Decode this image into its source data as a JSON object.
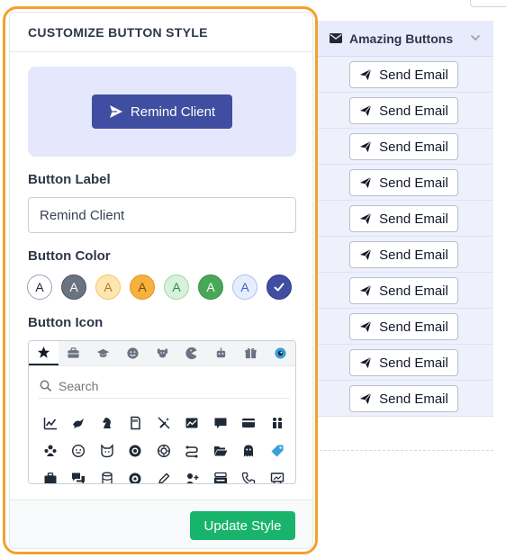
{
  "grid": {
    "column_header": "Amazing Buttons",
    "header_icon": "envelope-icon",
    "rows": [
      {
        "button_label": "Send Email",
        "icon": "paper-plane-icon"
      },
      {
        "button_label": "Send Email",
        "icon": "paper-plane-icon"
      },
      {
        "button_label": "Send Email",
        "icon": "paper-plane-icon"
      },
      {
        "button_label": "Send Email",
        "icon": "paper-plane-icon"
      },
      {
        "button_label": "Send Email",
        "icon": "paper-plane-icon"
      },
      {
        "button_label": "Send Email",
        "icon": "paper-plane-icon"
      },
      {
        "button_label": "Send Email",
        "icon": "paper-plane-icon"
      },
      {
        "button_label": "Send Email",
        "icon": "paper-plane-icon"
      },
      {
        "button_label": "Send Email",
        "icon": "paper-plane-icon"
      },
      {
        "button_label": "Send Email",
        "icon": "paper-plane-icon"
      }
    ]
  },
  "panel": {
    "title": "CUSTOMIZE BUTTON STYLE",
    "preview": {
      "label": "Remind Client",
      "icon": "paper-plane-icon",
      "color": "#3f4ea0"
    },
    "button_label": {
      "heading": "Button Label",
      "value": "Remind Client"
    },
    "button_color": {
      "heading": "Button Color",
      "swatches": [
        {
          "text": "A",
          "bg": "#ffffff",
          "fg": "#1f2937",
          "border": "#9ca3af",
          "selected": false
        },
        {
          "text": "A",
          "bg": "#6b7280",
          "fg": "#ffffff",
          "border": "#4b5563",
          "selected": false
        },
        {
          "text": "A",
          "bg": "#fde6b0",
          "fg": "#b7791f",
          "border": "#f6c46a",
          "selected": false
        },
        {
          "text": "A",
          "bg": "#f6b13f",
          "fg": "#7c4a03",
          "border": "#e0962a",
          "selected": false
        },
        {
          "text": "A",
          "bg": "#d6f2d9",
          "fg": "#2f855a",
          "border": "#9fd9a8",
          "selected": false
        },
        {
          "text": "A",
          "bg": "#48a857",
          "fg": "#ffffff",
          "border": "#3b8f49",
          "selected": false
        },
        {
          "text": "A",
          "bg": "#e6eefe",
          "fg": "#3b63d6",
          "border": "#a9bff2",
          "selected": false
        },
        {
          "text": "",
          "bg": "#3f4ea0",
          "fg": "#ffffff",
          "border": "#2f3c85",
          "selected": true
        }
      ]
    },
    "button_icon": {
      "heading": "Button Icon",
      "categories": [
        "star-icon",
        "briefcase-icon",
        "graduation-cap-icon",
        "smiley-icon",
        "dog-icon",
        "pacman-icon",
        "robot-icon",
        "gift-icon",
        "eye-icon"
      ],
      "active_category": 0,
      "search_placeholder": "Search",
      "icons": [
        "chart-line-icon",
        "bird-icon",
        "chess-knight-icon",
        "sd-card-icon",
        "wand-slash-icon",
        "image-chart-icon",
        "comment-icon",
        "credit-card-icon",
        "people-icon",
        "user-group-icon",
        "face-icon",
        "cat-face-icon",
        "badge-icon",
        "gear-circle-icon",
        "route-icon",
        "folder-open-icon",
        "ghost-icon",
        "tag-icon",
        "suitcase-icon",
        "chat-icon",
        "database-icon",
        "target-icon",
        "pen-icon",
        "user-plus-icon",
        "tray-icon",
        "phone-icon",
        "easel-icon"
      ]
    },
    "update_button_label": "Update Style",
    "colors": {
      "accent_outline": "#f4a02b",
      "update_green": "#19b46b"
    }
  }
}
